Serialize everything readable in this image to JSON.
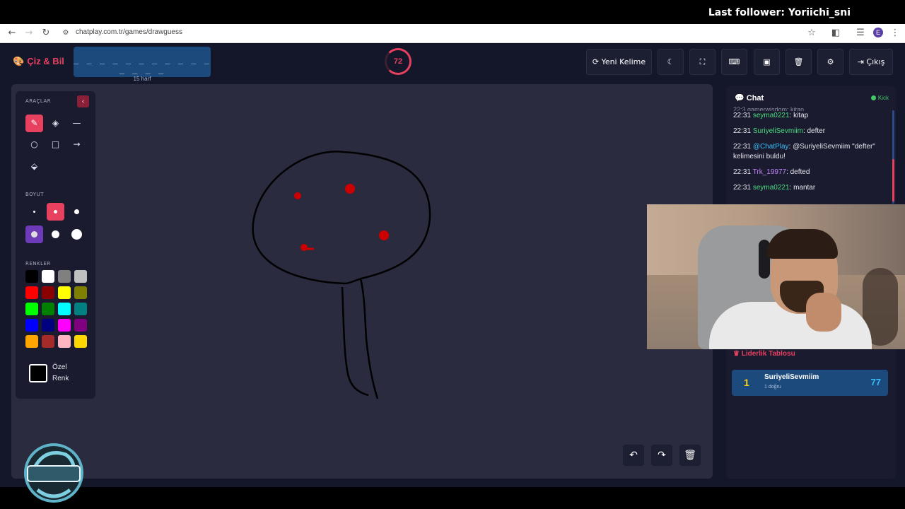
{
  "stream": {
    "last_follower": "Last follower: Yoriichi_sni"
  },
  "browser": {
    "url": "chatplay.com.tr/games/drawguess",
    "profile_initial": "E",
    "icons": [
      "back-icon",
      "forward-icon",
      "reload-icon",
      "site-settings-icon",
      "star-icon",
      "extensions-icon",
      "reading-list-icon",
      "menu-icon"
    ]
  },
  "header": {
    "brand": "Çiz & Bil",
    "word_mask": "_ _ _ _ _ _ _ _ _ _ _ _ _ _ _",
    "word_hint": "15 harf",
    "timer": "72",
    "new_word_label": "Yeni Kelime",
    "exit_label": "Çıkış",
    "icons": [
      "refresh-icon",
      "moon-icon",
      "fullscreen-icon",
      "keyboard-icon",
      "archive-icon",
      "trash-icon",
      "gear-icon",
      "logout-icon"
    ]
  },
  "tools": {
    "title": "ARAÇLAR",
    "size_title": "BOYUT",
    "colors_title": "RENKLER",
    "custom_color_label": "Özel Renk",
    "tool_icons": [
      "brush-icon",
      "eraser-icon",
      "line-icon",
      "circle-icon",
      "square-icon",
      "arrow-icon",
      "fill-bucket-icon"
    ],
    "active_tool": "brush",
    "colors": [
      "#000000",
      "#ffffff",
      "#808080",
      "#c0c0c0",
      "#ff0000",
      "#8b0000",
      "#ffff00",
      "#808000",
      "#00ff00",
      "#008000",
      "#00ffff",
      "#008080",
      "#0000ff",
      "#000080",
      "#ff00ff",
      "#800080",
      "#ffa500",
      "#a52a2a",
      "#ffb6c1",
      "#ffd700"
    ]
  },
  "actions": {
    "icons": [
      "undo-icon",
      "redo-icon",
      "clear-icon"
    ]
  },
  "chat": {
    "title": "Chat",
    "status": "Kick",
    "partial_top": "22:3 gamerwisdom: kitap",
    "messages": [
      {
        "time": "22:31",
        "user": "seyma0221",
        "text": ": kitap",
        "kind": "user"
      },
      {
        "time": "22:31",
        "user": "SuriyeliSevmiim",
        "text": ": defter",
        "kind": "user"
      },
      {
        "time": "22:31",
        "user": "@ChatPlay",
        "text": ": @SuriyeliSevmiim \"defter\" kelimesini buldu!",
        "kind": "sys"
      },
      {
        "time": "22:31",
        "user": "Trk_19977",
        "text": ": defted",
        "kind": "trk"
      },
      {
        "time": "22:31",
        "user": "seyma0221",
        "text": ": mantar",
        "kind": "user"
      }
    ]
  },
  "leaderboard": {
    "title": "Liderlik Tablosu",
    "entries": [
      {
        "rank": "1",
        "name": "SuriyeliSevmiim",
        "detail": "1 doğru",
        "score": "77"
      }
    ]
  },
  "accent": "#e8415f"
}
